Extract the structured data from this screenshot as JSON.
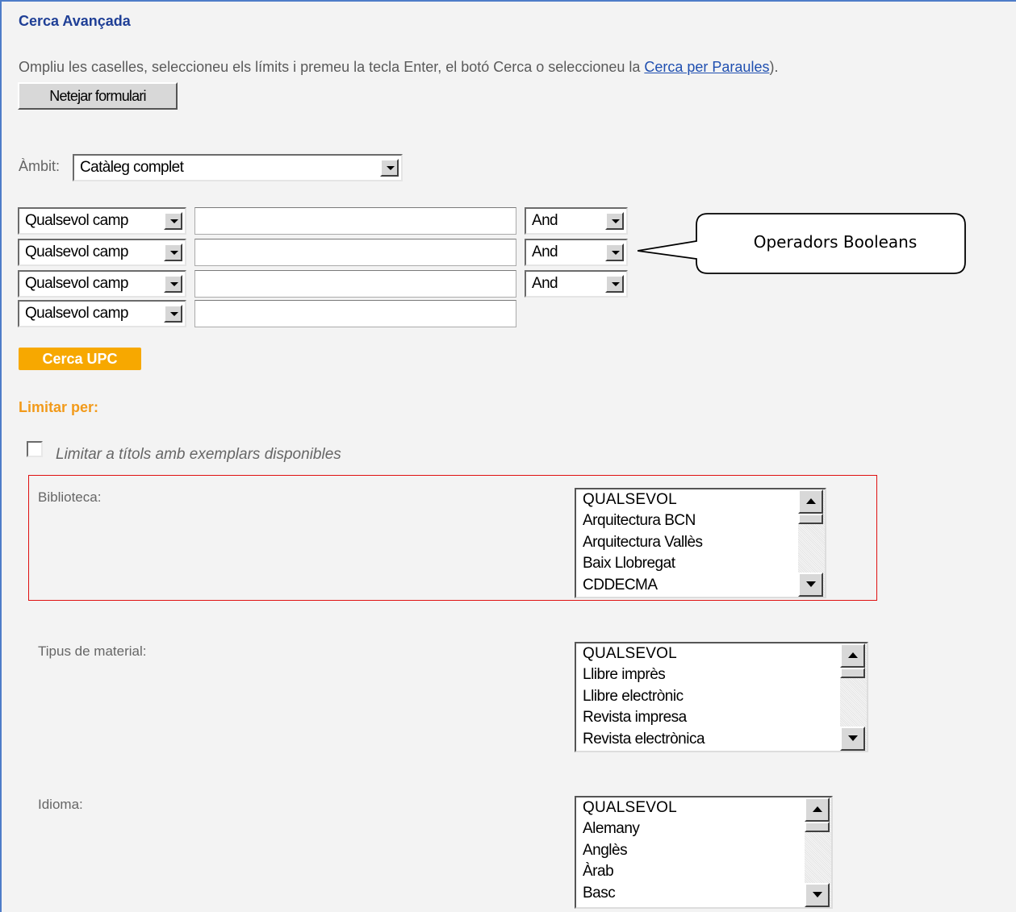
{
  "header": {
    "title": "Cerca Avançada"
  },
  "intro": {
    "text": "Ompliu les caselles, seleccioneu els límits i premeu la tecla Enter, el botó Cerca o seleccioneu la ",
    "link": "Cerca per Paraules",
    "suffix": ")."
  },
  "clear_button": "Netejar formulari",
  "scope": {
    "label": "Àmbit:",
    "value": "Catàleg complet"
  },
  "search_rows": [
    {
      "field": "Qualsevol camp",
      "value": "",
      "operator": "And"
    },
    {
      "field": "Qualsevol camp",
      "value": "",
      "operator": "And"
    },
    {
      "field": "Qualsevol camp",
      "value": "",
      "operator": "And"
    },
    {
      "field": "Qualsevol camp",
      "value": ""
    }
  ],
  "callout": {
    "text": "Operadors Booleans"
  },
  "search_button": "Cerca UPC",
  "limits": {
    "title": "Limitar per:",
    "available_only": {
      "label": "Limitar a títols amb exemplars disponibles",
      "checked": false
    },
    "library": {
      "label": "Biblioteca:",
      "options": [
        "QUALSEVOL",
        "Arquitectura BCN",
        "Arquitectura Vallès",
        "Baix Llobregat",
        "CDDECMA"
      ]
    },
    "material": {
      "label": "Tipus de material:",
      "options": [
        "QUALSEVOL",
        "Llibre imprès",
        "Llibre electrònic",
        "Revista impresa",
        "Revista electrònica"
      ]
    },
    "language": {
      "label": "Idioma:",
      "options": [
        "QUALSEVOL",
        "Alemany",
        "Anglès",
        "Àrab",
        "Basc"
      ]
    }
  },
  "colors": {
    "accent": "#f7a800",
    "title": "#1f3f96",
    "limit_title": "#f29a1a",
    "highlight_box": "#e01010",
    "frame": "#4d7cc8"
  }
}
